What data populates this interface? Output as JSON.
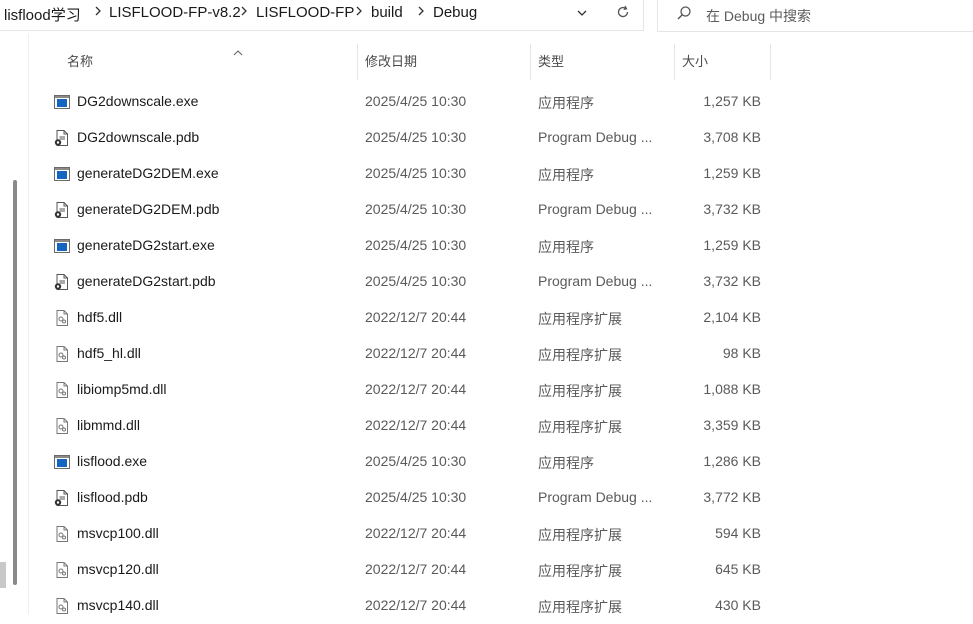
{
  "address_bar": {
    "crumbs": [
      "lisflood学习",
      "LISFLOOD-FP-v8.2",
      "LISFLOOD-FP",
      "build",
      "Debug"
    ],
    "separator_icon": "chevron-right-icon",
    "dropdown_icon": "chevron-down-icon",
    "refresh_icon": "refresh-icon"
  },
  "search": {
    "placeholder": "在 Debug 中搜索",
    "icon": "search-icon"
  },
  "columns": {
    "name": "名称",
    "date": "修改日期",
    "type": "类型",
    "size": "大小",
    "sort_icon": "sort-up-icon"
  },
  "files": [
    {
      "name": "DG2downscale.exe",
      "date": "2025/4/25 10:30",
      "type": "应用程序",
      "size": "1,257 KB",
      "icon": "exe"
    },
    {
      "name": "DG2downscale.pdb",
      "date": "2025/4/25 10:30",
      "type": "Program Debug ...",
      "size": "3,708 KB",
      "icon": "pdb"
    },
    {
      "name": "generateDG2DEM.exe",
      "date": "2025/4/25 10:30",
      "type": "应用程序",
      "size": "1,259 KB",
      "icon": "exe"
    },
    {
      "name": "generateDG2DEM.pdb",
      "date": "2025/4/25 10:30",
      "type": "Program Debug ...",
      "size": "3,732 KB",
      "icon": "pdb"
    },
    {
      "name": "generateDG2start.exe",
      "date": "2025/4/25 10:30",
      "type": "应用程序",
      "size": "1,259 KB",
      "icon": "exe"
    },
    {
      "name": "generateDG2start.pdb",
      "date": "2025/4/25 10:30",
      "type": "Program Debug ...",
      "size": "3,732 KB",
      "icon": "pdb"
    },
    {
      "name": "hdf5.dll",
      "date": "2022/12/7 20:44",
      "type": "应用程序扩展",
      "size": "2,104 KB",
      "icon": "dll"
    },
    {
      "name": "hdf5_hl.dll",
      "date": "2022/12/7 20:44",
      "type": "应用程序扩展",
      "size": "98 KB",
      "icon": "dll"
    },
    {
      "name": "libiomp5md.dll",
      "date": "2022/12/7 20:44",
      "type": "应用程序扩展",
      "size": "1,088 KB",
      "icon": "dll"
    },
    {
      "name": "libmmd.dll",
      "date": "2022/12/7 20:44",
      "type": "应用程序扩展",
      "size": "3,359 KB",
      "icon": "dll"
    },
    {
      "name": "lisflood.exe",
      "date": "2025/4/25 10:30",
      "type": "应用程序",
      "size": "1,286 KB",
      "icon": "exe"
    },
    {
      "name": "lisflood.pdb",
      "date": "2025/4/25 10:30",
      "type": "Program Debug ...",
      "size": "3,772 KB",
      "icon": "pdb"
    },
    {
      "name": "msvcp100.dll",
      "date": "2022/12/7 20:44",
      "type": "应用程序扩展",
      "size": "594 KB",
      "icon": "dll"
    },
    {
      "name": "msvcp120.dll",
      "date": "2022/12/7 20:44",
      "type": "应用程序扩展",
      "size": "645 KB",
      "icon": "dll"
    },
    {
      "name": "msvcp140.dll",
      "date": "2022/12/7 20:44",
      "type": "应用程序扩展",
      "size": "430 KB",
      "icon": "dll"
    }
  ],
  "colors": {
    "exe_blue": "#1565c0",
    "text": "#1a1a1a",
    "muted": "#5a5a5a"
  }
}
